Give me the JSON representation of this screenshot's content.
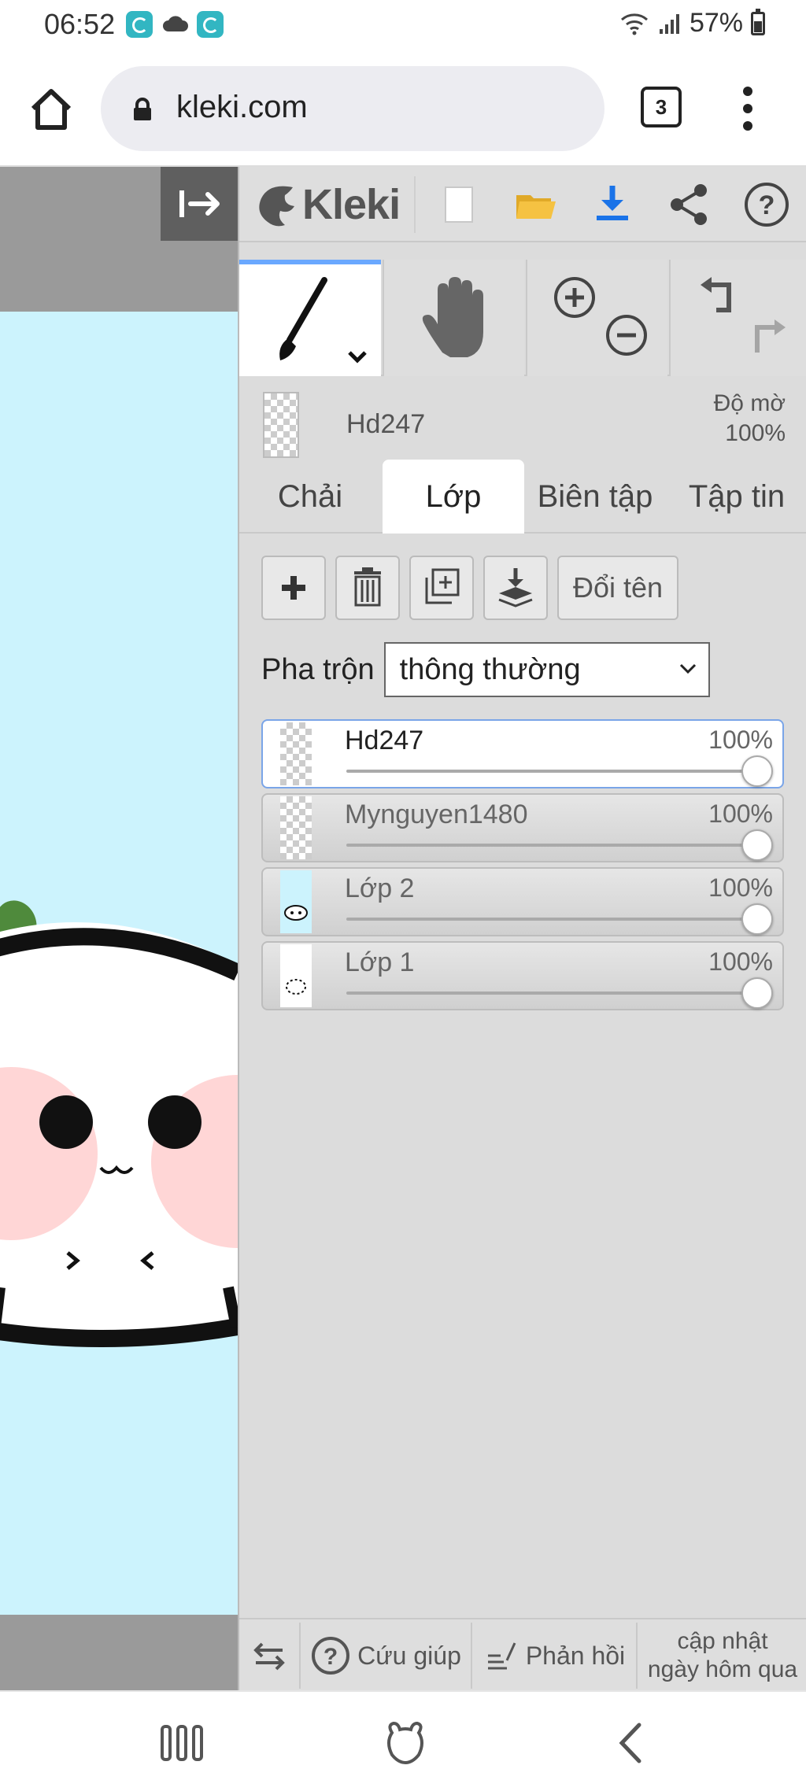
{
  "status_bar": {
    "time": "06:52",
    "battery_percent": "57%",
    "icons": [
      "app-notification-icon",
      "cloud-icon",
      "app-notification-icon",
      "wifi-icon",
      "signal-icon",
      "battery-icon"
    ]
  },
  "browser": {
    "url": "kleki.com",
    "tab_count": "3"
  },
  "app": {
    "logo_text": "Kleki",
    "toolbar_icons": [
      "new-image-icon",
      "open-folder-icon",
      "download-icon",
      "share-icon",
      "help-icon"
    ]
  },
  "current_layer": {
    "name": "Hd247",
    "opacity_label": "Độ mờ",
    "opacity_value": "100%"
  },
  "tabs": [
    {
      "label": "Chải",
      "active": false
    },
    {
      "label": "Lớp",
      "active": true
    },
    {
      "label": "Biên tập",
      "active": false
    },
    {
      "label": "Tập tin",
      "active": false
    }
  ],
  "layer_buttons": {
    "rename_label": "Đổi tên",
    "icons": [
      "add-layer-icon",
      "delete-layer-icon",
      "duplicate-layer-icon",
      "merge-down-icon"
    ]
  },
  "blend": {
    "label": "Pha trộn",
    "value": "thông thường"
  },
  "layers": [
    {
      "name": "Hd247",
      "opacity": "100%",
      "opacity_value": 1.0,
      "selected": true
    },
    {
      "name": "Mynguyen1480",
      "opacity": "100%",
      "opacity_value": 1.0,
      "selected": false
    },
    {
      "name": "Lớp 2",
      "opacity": "100%",
      "opacity_value": 1.0,
      "selected": false
    },
    {
      "name": "Lớp 1",
      "opacity": "100%",
      "opacity_value": 1.0,
      "selected": false
    }
  ],
  "bottom_bar": {
    "help_label": "Cứu giúp",
    "feedback_label": "Phản hồi",
    "update_line1": "cập nhật",
    "update_line2": "ngày hôm qua"
  },
  "colors": {
    "canvas_background": "#ccf3fd",
    "panel_background": "#dcdcdc",
    "accent_blue": "#1a73e8",
    "folder_yellow": "#f5c242",
    "selected_border": "#7aa5e8"
  }
}
